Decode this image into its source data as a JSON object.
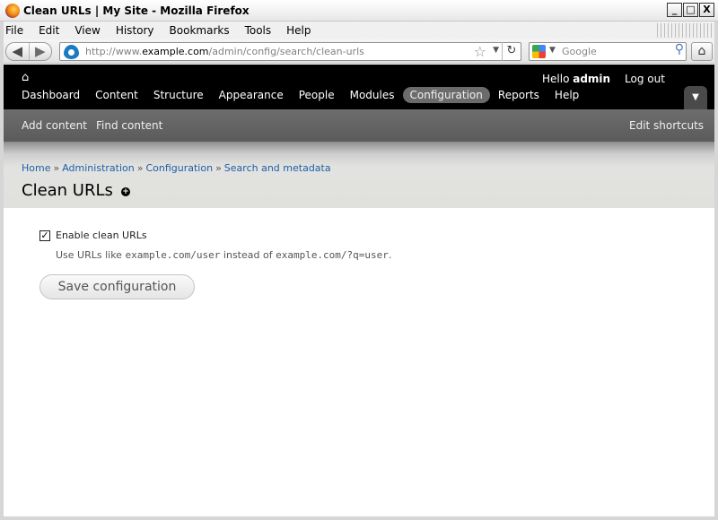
{
  "window": {
    "title": "Clean URLs | My Site - Mozilla Firefox",
    "controls": [
      "_",
      "□",
      "X"
    ]
  },
  "browser": {
    "menu": [
      "File",
      "Edit",
      "View",
      "History",
      "Bookmarks",
      "Tools",
      "Help"
    ],
    "url_prefix": "http://www.",
    "url_host": "example.com",
    "url_path": "/admin/config/search/clean-urls",
    "search_placeholder": "Google"
  },
  "toolbar": {
    "greeting": "Hello ",
    "user": "admin",
    "logout": "Log out",
    "menu": [
      "Dashboard",
      "Content",
      "Structure",
      "Appearance",
      "People",
      "Modules",
      "Configuration",
      "Reports",
      "Help"
    ],
    "active_item": "Configuration",
    "shortcuts": [
      "Add content",
      "Find content"
    ],
    "edit_shortcuts": "Edit shortcuts"
  },
  "breadcrumb": [
    "Home",
    "Administration",
    "Configuration",
    "Search and metadata"
  ],
  "page": {
    "title": "Clean URLs",
    "checkbox_label": "Enable clean URLs",
    "checkbox_checked": true,
    "desc_pre": "Use URLs like ",
    "desc_code1": "example.com/user",
    "desc_mid": " instead of ",
    "desc_code2": "example.com/?q=user",
    "desc_post": ".",
    "save_label": "Save configuration"
  }
}
